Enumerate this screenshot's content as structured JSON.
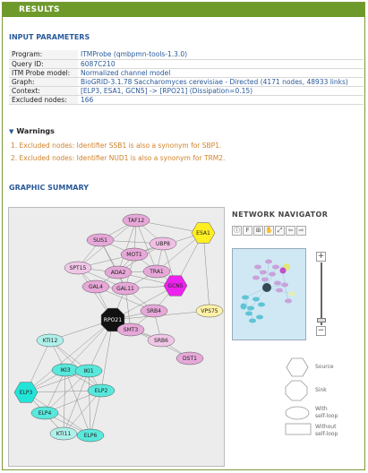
{
  "header": {
    "title": "RESULTS"
  },
  "input_parameters": {
    "title": "INPUT PARAMETERS",
    "rows": [
      {
        "key": "Program:",
        "value": "ITMProbe (qmbpmn-tools-1.3.0)"
      },
      {
        "key": "Query ID:",
        "value": "6087C210"
      },
      {
        "key": "ITM Probe model:",
        "value": "Normalized channel model"
      },
      {
        "key": "Graph:",
        "value": "BioGRID-3.1.78 Saccharomyces cerevisiae - Directed (4171 nodes, 48933 links)"
      },
      {
        "key": "Context:",
        "value": "[ELP3, ESA1, GCN5] -> [RPO21] (Dissipation=0.15)"
      },
      {
        "key": "Excluded nodes:",
        "value": "166"
      }
    ]
  },
  "warnings": {
    "title": "Warnings",
    "items": [
      "1.  Excluded nodes: Identifier SSB1 is also a synonym for SBP1.",
      "2.  Excluded nodes: Identifier NUD1 is also a synonym for TRM2."
    ]
  },
  "graphic_summary": {
    "title": "GRAPHIC SUMMARY",
    "nodes": [
      {
        "id": "TAF12",
        "shape": "ellipse",
        "color": "#e6a8d8"
      },
      {
        "id": "ESA1",
        "shape": "hexagon",
        "color": "#ffee22"
      },
      {
        "id": "SUS1",
        "shape": "ellipse",
        "color": "#e6a8d8"
      },
      {
        "id": "UBP8",
        "shape": "ellipse",
        "color": "#f0bfe4"
      },
      {
        "id": "MOT1",
        "shape": "ellipse",
        "color": "#e6a8d8"
      },
      {
        "id": "SPT15",
        "shape": "ellipse",
        "color": "#f0c6e6"
      },
      {
        "id": "ADA2",
        "shape": "ellipse",
        "color": "#e6a8d8"
      },
      {
        "id": "TRA1",
        "shape": "ellipse",
        "color": "#e6a8d8"
      },
      {
        "id": "GCN5",
        "shape": "hexagon",
        "color": "#ee22ee"
      },
      {
        "id": "GAL4",
        "shape": "ellipse",
        "color": "#e6a8d8"
      },
      {
        "id": "GAL11",
        "shape": "ellipse",
        "color": "#e6a8d8"
      },
      {
        "id": "RPO21",
        "shape": "octagon",
        "color": "#111111"
      },
      {
        "id": "SRB4",
        "shape": "ellipse",
        "color": "#e6a8d8"
      },
      {
        "id": "VPS75",
        "shape": "ellipse",
        "color": "#fff2a8"
      },
      {
        "id": "SMT3",
        "shape": "ellipse",
        "color": "#e6a8d8"
      },
      {
        "id": "SRB6",
        "shape": "ellipse",
        "color": "#f0c6e6"
      },
      {
        "id": "DST1",
        "shape": "ellipse",
        "color": "#e6a8d8"
      },
      {
        "id": "KTI12",
        "shape": "ellipse",
        "color": "#aef0ea"
      },
      {
        "id": "IKI3",
        "shape": "ellipse",
        "color": "#58e8dc"
      },
      {
        "id": "IKI1",
        "shape": "ellipse",
        "color": "#58e8dc"
      },
      {
        "id": "ELP3",
        "shape": "hexagon",
        "color": "#22e4d8"
      },
      {
        "id": "ELP2",
        "shape": "ellipse",
        "color": "#58e8dc"
      },
      {
        "id": "ELP4",
        "shape": "ellipse",
        "color": "#58e8dc"
      },
      {
        "id": "KTI11",
        "shape": "ellipse",
        "color": "#aef0ea"
      },
      {
        "id": "ELP6",
        "shape": "ellipse",
        "color": "#58e8dc"
      }
    ],
    "edges": [
      [
        "TAF12",
        "SUS1"
      ],
      [
        "TAF12",
        "UBP8"
      ],
      [
        "TAF12",
        "MOT1"
      ],
      [
        "TAF12",
        "ESA1"
      ],
      [
        "TAF12",
        "ADA2"
      ],
      [
        "TAF12",
        "TRA1"
      ],
      [
        "TAF12",
        "SPT15"
      ],
      [
        "SUS1",
        "UBP8"
      ],
      [
        "SUS1",
        "MOT1"
      ],
      [
        "SUS1",
        "ADA2"
      ],
      [
        "SUS1",
        "SPT15"
      ],
      [
        "SUS1",
        "GAL11"
      ],
      [
        "UBP8",
        "MOT1"
      ],
      [
        "UBP8",
        "ADA2"
      ],
      [
        "UBP8",
        "TRA1"
      ],
      [
        "UBP8",
        "GCN5"
      ],
      [
        "MOT1",
        "SPT15"
      ],
      [
        "MOT1",
        "ADA2"
      ],
      [
        "MOT1",
        "TRA1"
      ],
      [
        "MOT1",
        "GAL11"
      ],
      [
        "SPT15",
        "ADA2"
      ],
      [
        "SPT15",
        "GAL4"
      ],
      [
        "SPT15",
        "GAL11"
      ],
      [
        "SPT15",
        "RPO21"
      ],
      [
        "ADA2",
        "TRA1"
      ],
      [
        "ADA2",
        "GCN5"
      ],
      [
        "ADA2",
        "GAL4"
      ],
      [
        "ADA2",
        "GAL11"
      ],
      [
        "TRA1",
        "GCN5"
      ],
      [
        "TRA1",
        "ESA1"
      ],
      [
        "TRA1",
        "GAL11"
      ],
      [
        "ESA1",
        "VPS75"
      ],
      [
        "ESA1",
        "GCN5"
      ],
      [
        "ESA1",
        "MOT1"
      ],
      [
        "GCN5",
        "SRB4"
      ],
      [
        "GCN5",
        "GAL11"
      ],
      [
        "GCN5",
        "RPO21"
      ],
      [
        "GAL4",
        "GAL11"
      ],
      [
        "GAL4",
        "RPO21"
      ],
      [
        "GAL4",
        "SRB4"
      ],
      [
        "GAL11",
        "SRB4"
      ],
      [
        "GAL11",
        "RPO21"
      ],
      [
        "GAL11",
        "SMT3"
      ],
      [
        "RPO21",
        "SRB4"
      ],
      [
        "RPO21",
        "SMT3"
      ],
      [
        "RPO21",
        "VPS75"
      ],
      [
        "RPO21",
        "SRB6"
      ],
      [
        "RPO21",
        "DST1"
      ],
      [
        "RPO21",
        "KTI12"
      ],
      [
        "RPO21",
        "IKI3"
      ],
      [
        "RPO21",
        "IKI1"
      ],
      [
        "RPO21",
        "ELP2"
      ],
      [
        "RPO21",
        "ELP3"
      ],
      [
        "SRB4",
        "SRB6"
      ],
      [
        "SRB4",
        "SMT3"
      ],
      [
        "SMT3",
        "SRB6"
      ],
      [
        "SRB6",
        "DST1"
      ],
      [
        "KTI12",
        "IKI3"
      ],
      [
        "KTI12",
        "IKI1"
      ],
      [
        "KTI12",
        "ELP3"
      ],
      [
        "KTI12",
        "ELP2"
      ],
      [
        "IKI3",
        "IKI1"
      ],
      [
        "IKI3",
        "ELP2"
      ],
      [
        "IKI3",
        "ELP3"
      ],
      [
        "IKI3",
        "ELP4"
      ],
      [
        "IKI3",
        "KTI11"
      ],
      [
        "IKI3",
        "ELP6"
      ],
      [
        "IKI1",
        "ELP2"
      ],
      [
        "IKI1",
        "ELP3"
      ],
      [
        "IKI1",
        "ELP4"
      ],
      [
        "IKI1",
        "KTI11"
      ],
      [
        "IKI1",
        "ELP6"
      ],
      [
        "ELP3",
        "ELP2"
      ],
      [
        "ELP3",
        "ELP4"
      ],
      [
        "ELP3",
        "KTI11"
      ],
      [
        "ELP3",
        "ELP6"
      ],
      [
        "ELP2",
        "ELP4"
      ],
      [
        "ELP2",
        "KTI11"
      ],
      [
        "ELP2",
        "ELP6"
      ],
      [
        "ELP4",
        "KTI11"
      ],
      [
        "ELP4",
        "ELP6"
      ],
      [
        "KTI11",
        "ELP6"
      ]
    ]
  },
  "navigator": {
    "title": "NETWORK NAVIGATOR",
    "buttons": [
      "ⓘ",
      "F",
      "⊞",
      "✋",
      "⤢",
      "⇦",
      "⇨"
    ],
    "zoom_in": "+",
    "zoom_out": "−"
  },
  "legend": {
    "source": "Source",
    "sink": "Sink",
    "with_self_loop": "With\nself-loop",
    "without_self_loop": "Without\nself-loop"
  }
}
